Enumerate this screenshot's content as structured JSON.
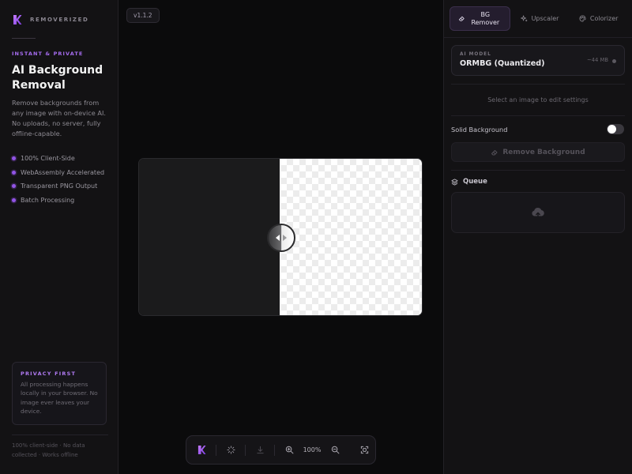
{
  "brand": {
    "name": "REMOVERIZED",
    "accent": "#a66cf0"
  },
  "sidebar": {
    "eyebrow": "INSTANT & PRIVATE",
    "title": "AI Background Removal",
    "description": "Remove backgrounds from any image with on-device AI. No uploads, no server, fully offline-capable.",
    "features": [
      {
        "label": "100% Client-Side"
      },
      {
        "label": "WebAssembly Accelerated"
      },
      {
        "label": "Transparent PNG Output"
      },
      {
        "label": "Batch Processing"
      }
    ],
    "privacy": {
      "title": "PRIVACY FIRST",
      "text": "All processing happens locally in your browser. No image ever leaves your device."
    },
    "footer": "100% client-side · No data collected · Works offline"
  },
  "version": "v1.1.2",
  "toolbar": {
    "zoom": "100%"
  },
  "panel": {
    "tabs": [
      {
        "label": "BG Remover",
        "icon": "eraser-icon",
        "active": true
      },
      {
        "label": "Upscaler",
        "icon": "sparkle-icon",
        "active": false
      },
      {
        "label": "Colorizer",
        "icon": "palette-icon",
        "active": false
      }
    ],
    "model": {
      "label": "AI MODEL",
      "name": "ORMBG (Quantized)",
      "size": "~44 MB"
    },
    "hint": "Select an image to edit settings",
    "solid_background": {
      "label": "Solid Background",
      "enabled": false
    },
    "remove_button": "Remove Background",
    "queue": {
      "title": "Queue"
    }
  }
}
